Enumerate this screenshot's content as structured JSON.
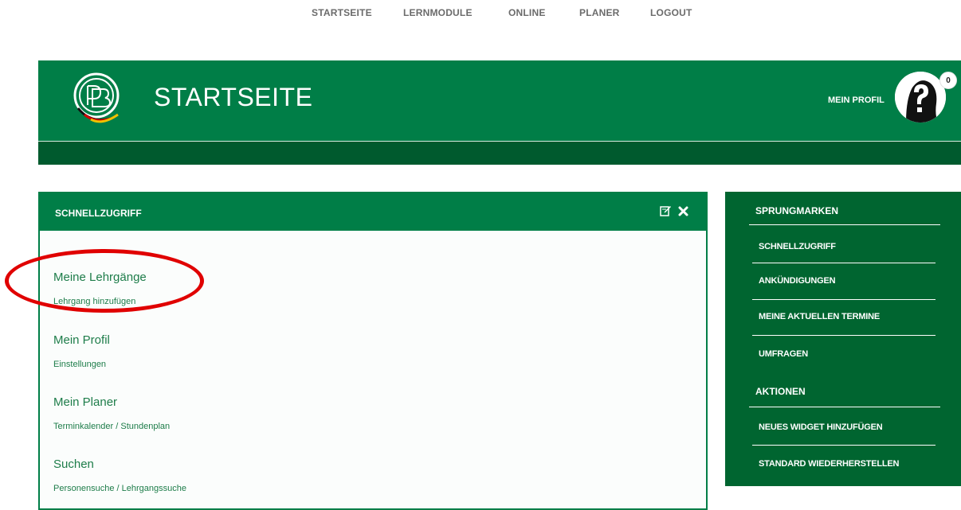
{
  "topnav": {
    "items": [
      "STARTSEITE",
      "LERNMODULE",
      "ONLINE",
      "PLANER",
      "LOGOUT"
    ]
  },
  "header": {
    "title": "STARTSEITE",
    "profile_label": "MEIN PROFIL",
    "notification_count": "0",
    "logo": "dfb-logo-icon",
    "avatar": "question-mark-avatar-icon"
  },
  "quick_access": {
    "title": "SCHNELLZUGRIFF",
    "tools": [
      "edit-icon",
      "close-icon"
    ],
    "entries": [
      {
        "heading": "Meine Lehrgänge",
        "sub": "Lehrgang hinzufügen"
      },
      {
        "heading": "Mein Profil",
        "sub": "Einstellungen"
      },
      {
        "heading": "Mein Planer",
        "sub": "Terminkalender / Stundenplan"
      },
      {
        "heading": "Suchen",
        "sub": "Personensuche / Lehrgangssuche"
      }
    ]
  },
  "sidebar": {
    "jump_heading": "SPRUNGMARKEN",
    "jump_items": [
      "SCHNELLZUGRIFF",
      "ANKÜNDIGUNGEN",
      "MEINE AKTUELLEN TERMINE",
      "UMFRAGEN"
    ],
    "actions_heading": "AKTIONEN",
    "action_items": [
      "NEUES WIDGET HINZUFÜGEN",
      "STANDARD WIEDERHERSTELLEN"
    ]
  },
  "colors": {
    "brand_green": "#007e47",
    "dark_green": "#005a2e",
    "sidebar_green": "#006530",
    "annotation_red": "#e00000"
  }
}
